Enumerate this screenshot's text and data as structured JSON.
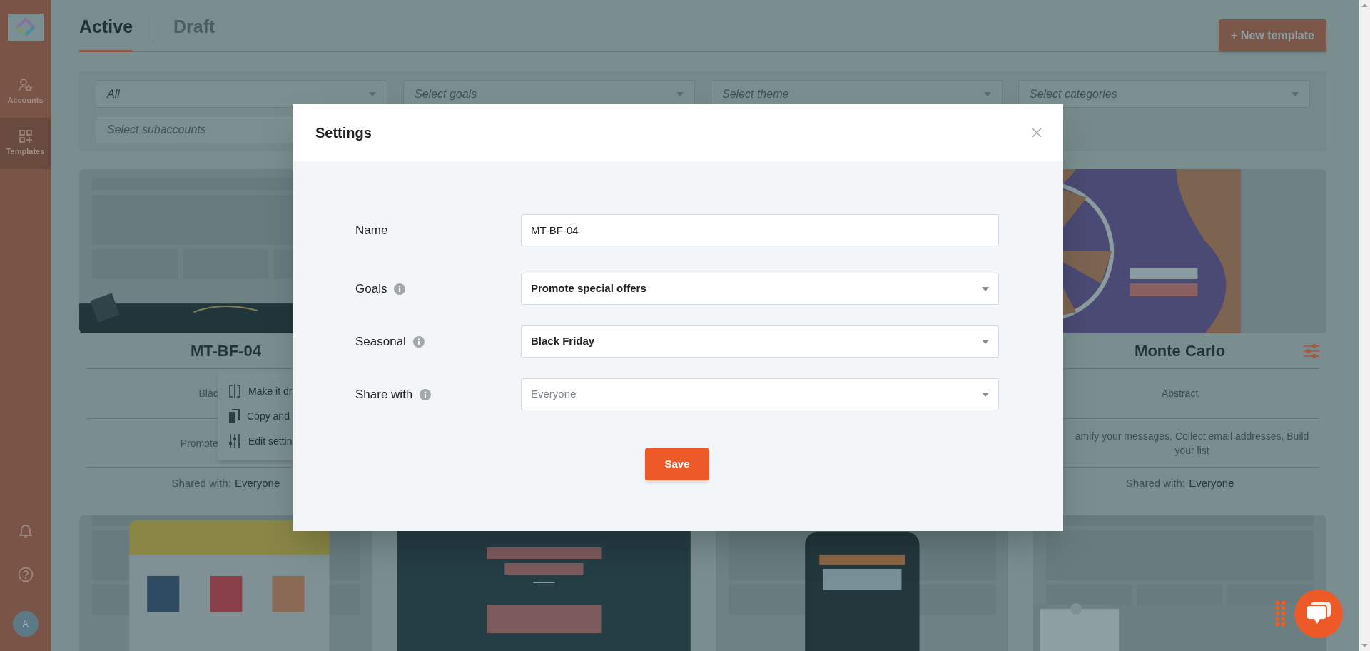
{
  "sidebar": {
    "items": [
      {
        "label": "Accounts",
        "kind": "accounts",
        "selected": false
      },
      {
        "label": "Templates",
        "kind": "templates",
        "selected": true
      }
    ],
    "avatar": "A"
  },
  "tabs": [
    {
      "label": "Active",
      "selected": true
    },
    {
      "label": "Draft",
      "selected": false
    }
  ],
  "new_template_button": "+ New template",
  "filters": [
    {
      "value": "All"
    },
    {
      "placeholder": "Select goals"
    },
    {
      "placeholder": "Select theme"
    },
    {
      "placeholder": "Select categories"
    },
    {
      "placeholder": "Select subaccounts"
    }
  ],
  "cards": [
    {
      "kind": "right_covered",
      "title": "MT-BF-04",
      "category": "Blac",
      "goals": "Promote",
      "shared_label": "Shared with:",
      "shared_value": "Everyone",
      "menu": [
        "Make it dr",
        "Copy and",
        "Edit settin"
      ]
    },
    {
      "kind": "left_covered",
      "title": "Monte Carlo",
      "category": "Abstract",
      "goals": "amify your messages, Collect email addresses, Build your list",
      "shared_label": "Shared with:",
      "shared_value": "Everyone"
    }
  ],
  "modal": {
    "title": "Settings",
    "fields": [
      {
        "label": "Name",
        "kind": "text",
        "info": false,
        "value": "MT-BF-04"
      },
      {
        "label": "Goals",
        "kind": "select",
        "info": true,
        "value": "Promote special offers"
      },
      {
        "label": "Seasonal",
        "kind": "select",
        "info": true,
        "value": "Black Friday"
      },
      {
        "label": "Share with",
        "kind": "select",
        "info": true,
        "placeholder": "Everyone"
      }
    ],
    "save_button": "Save"
  }
}
